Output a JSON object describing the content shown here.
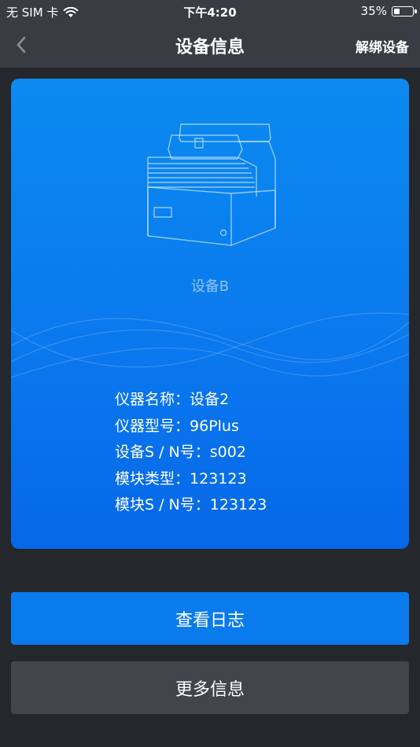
{
  "status_bar": {
    "carrier": "无 SIM 卡",
    "time": "下午4:20",
    "battery": "35%",
    "battery_level": 0.35
  },
  "nav": {
    "title": "设备信息",
    "action": "解绑设备",
    "back_icon": "chevron-left-icon"
  },
  "device": {
    "caption": "设备B",
    "info": [
      {
        "label": "仪器名称：",
        "value": "设备2"
      },
      {
        "label": "仪器型号：",
        "value": "96Plus"
      },
      {
        "label": "设备S / N号：",
        "value": "s002"
      },
      {
        "label": "模块类型：",
        "value": "123123"
      },
      {
        "label": "模块S / N号：",
        "value": "123123"
      }
    ]
  },
  "buttons": {
    "view_log": "查看日志",
    "more_info": "更多信息"
  },
  "colors": {
    "accent": "#0a7bec",
    "background": "#24272c",
    "navbar": "#393d43",
    "secondary_button": "#41464d"
  }
}
